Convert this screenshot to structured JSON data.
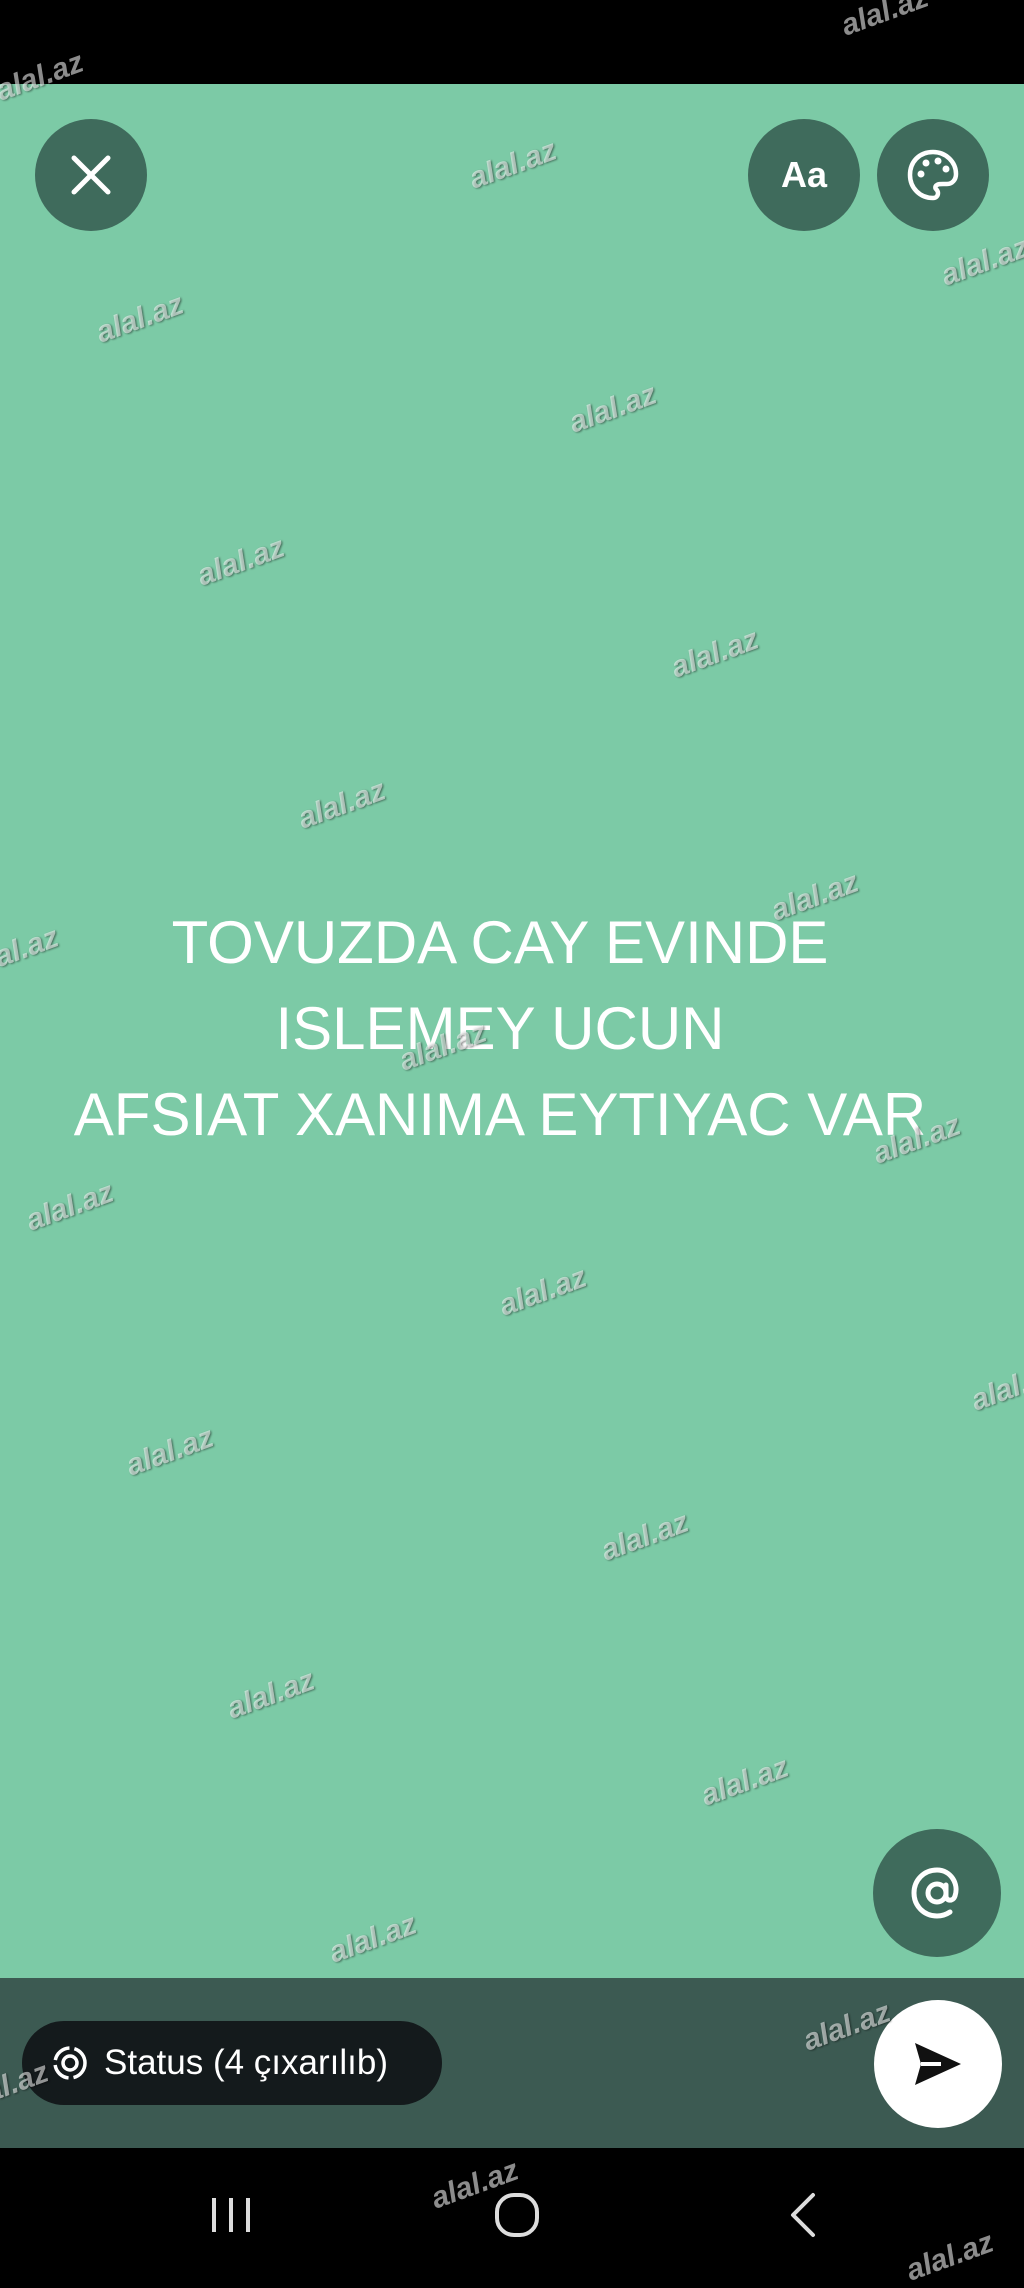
{
  "status_text": {
    "lines": [
      "TOVUZDA CAY EVINDE",
      "ISLEMEY UCUN",
      "AFSIAT XANIMA EYTIYAC VAR"
    ]
  },
  "toolbar": {
    "font_button_label": "Aa",
    "close_icon": "close-icon",
    "palette_icon": "palette-icon"
  },
  "mention_icon": "at-sign-icon",
  "audience": {
    "label": "Status (4 çıxarılıb)",
    "icon": "status-circle-icon"
  },
  "send_icon": "send-icon",
  "watermark": "alal.az",
  "colors": {
    "canvas_background": "#7ccaa6",
    "button_background": "#3f6b5c",
    "bottom_bar": "#3c5a52",
    "chip_background": "#141a1c"
  },
  "navigation": [
    "recent-apps-icon",
    "home-icon",
    "back-icon"
  ]
}
